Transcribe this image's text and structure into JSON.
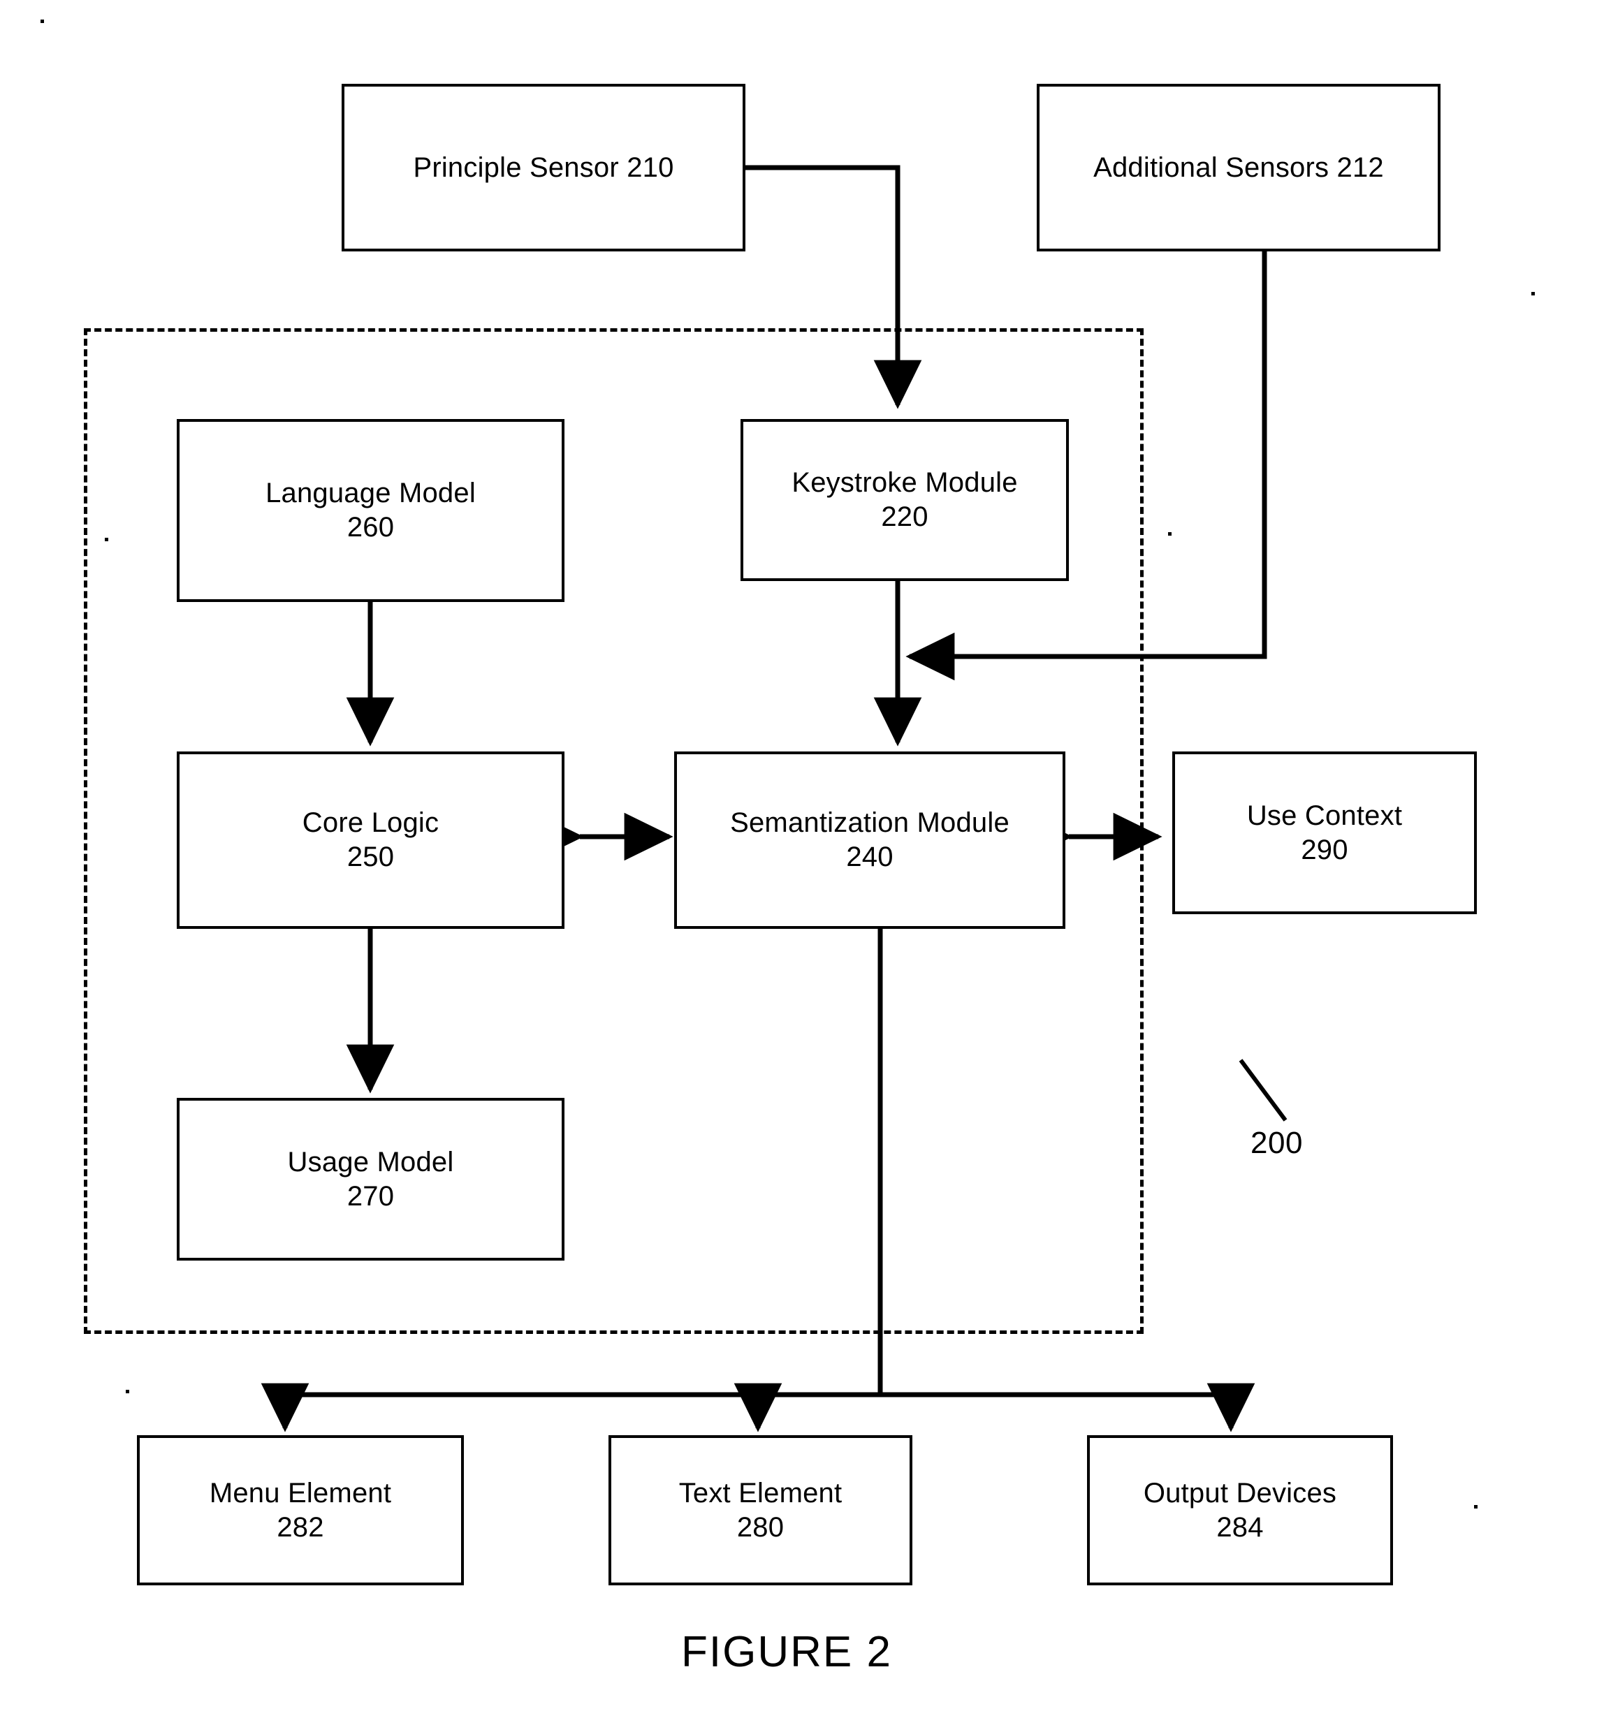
{
  "figure": {
    "caption": "FIGURE 2",
    "system_ref": "200"
  },
  "nodes": {
    "principle_sensor": {
      "label": "Principle Sensor 210",
      "ref": "210",
      "single_line": true
    },
    "additional_sensors": {
      "label": "Additional Sensors 212",
      "ref": "212",
      "single_line": true
    },
    "language_model": {
      "label": "Language Model",
      "ref": "260"
    },
    "keystroke_module": {
      "label": "Keystroke Module",
      "ref": "220"
    },
    "core_logic": {
      "label": "Core Logic",
      "ref": "250"
    },
    "semantization_module": {
      "label": "Semantization Module",
      "ref": "240"
    },
    "use_context": {
      "label": "Use Context",
      "ref": "290"
    },
    "usage_model": {
      "label": "Usage Model",
      "ref": "270"
    },
    "menu_element": {
      "label": "Menu Element",
      "ref": "282"
    },
    "text_element": {
      "label": "Text Element",
      "ref": "280"
    },
    "output_devices": {
      "label": "Output Devices",
      "ref": "284"
    }
  },
  "colors": {
    "ink": "#000000",
    "paper": "#ffffff"
  }
}
